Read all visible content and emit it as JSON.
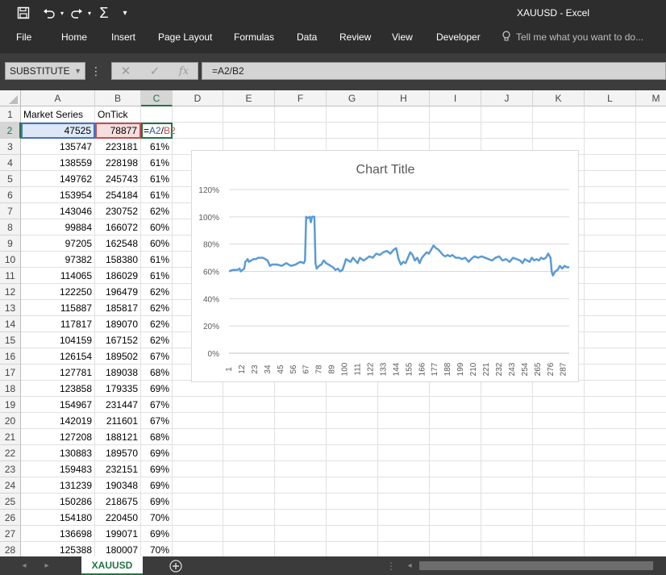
{
  "window": {
    "title": "XAUUSD - Excel"
  },
  "ribbon_tabs": [
    "File",
    "Home",
    "Insert",
    "Page Layout",
    "Formulas",
    "Data",
    "Review",
    "View",
    "Developer"
  ],
  "tell_me": "Tell me what you want to do...",
  "formula_bar": {
    "name_box": "SUBSTITUTE",
    "formula": "=A2/B2",
    "fx": "fx"
  },
  "columns": [
    "A",
    "B",
    "C",
    "D",
    "E",
    "F",
    "G",
    "H",
    "I",
    "J",
    "K",
    "L",
    "M"
  ],
  "headers": {
    "a": "Market Series",
    "b": "OnTick"
  },
  "edit_cell": {
    "eq": "=",
    "ref1": "A2",
    "slash": "/",
    "ref2": "B2"
  },
  "rows": [
    {
      "r": "1"
    },
    {
      "r": "2",
      "a": "47525",
      "b": "78877"
    },
    {
      "r": "3",
      "a": "135747",
      "b": "223181",
      "c": "61%"
    },
    {
      "r": "4",
      "a": "138559",
      "b": "228198",
      "c": "61%"
    },
    {
      "r": "5",
      "a": "149762",
      "b": "245743",
      "c": "61%"
    },
    {
      "r": "6",
      "a": "153954",
      "b": "254184",
      "c": "61%"
    },
    {
      "r": "7",
      "a": "143046",
      "b": "230752",
      "c": "62%"
    },
    {
      "r": "8",
      "a": "99884",
      "b": "166072",
      "c": "60%"
    },
    {
      "r": "9",
      "a": "97205",
      "b": "162548",
      "c": "60%"
    },
    {
      "r": "10",
      "a": "97382",
      "b": "158380",
      "c": "61%"
    },
    {
      "r": "11",
      "a": "114065",
      "b": "186029",
      "c": "61%"
    },
    {
      "r": "12",
      "a": "122250",
      "b": "196479",
      "c": "62%"
    },
    {
      "r": "13",
      "a": "115887",
      "b": "185817",
      "c": "62%"
    },
    {
      "r": "14",
      "a": "117817",
      "b": "189070",
      "c": "62%"
    },
    {
      "r": "15",
      "a": "104159",
      "b": "167152",
      "c": "62%"
    },
    {
      "r": "16",
      "a": "126154",
      "b": "189502",
      "c": "67%"
    },
    {
      "r": "17",
      "a": "127781",
      "b": "189038",
      "c": "68%"
    },
    {
      "r": "18",
      "a": "123858",
      "b": "179335",
      "c": "69%"
    },
    {
      "r": "19",
      "a": "154967",
      "b": "231447",
      "c": "67%"
    },
    {
      "r": "20",
      "a": "142019",
      "b": "211601",
      "c": "67%"
    },
    {
      "r": "21",
      "a": "127208",
      "b": "188121",
      "c": "68%"
    },
    {
      "r": "22",
      "a": "130883",
      "b": "189570",
      "c": "69%"
    },
    {
      "r": "23",
      "a": "159483",
      "b": "232151",
      "c": "69%"
    },
    {
      "r": "24",
      "a": "131239",
      "b": "190348",
      "c": "69%"
    },
    {
      "r": "25",
      "a": "150286",
      "b": "218675",
      "c": "69%"
    },
    {
      "r": "26",
      "a": "154180",
      "b": "220450",
      "c": "70%"
    },
    {
      "r": "27",
      "a": "136698",
      "b": "199071",
      "c": "69%"
    },
    {
      "r": "28",
      "a": "125388",
      "b": "180007",
      "c": "70%"
    }
  ],
  "sheet_tab": "XAUUSD",
  "colors": {
    "excel_green": "#217346",
    "series": "#5b9bd5",
    "ref_blue": "#2f5597",
    "ref_red": "#c0504d"
  },
  "chart_data": {
    "type": "line",
    "title": "Chart Title",
    "ylim": [
      0,
      1.2
    ],
    "y_ticks": [
      "0%",
      "20%",
      "40%",
      "60%",
      "80%",
      "100%",
      "120%"
    ],
    "x_ticks": [
      "1",
      "12",
      "23",
      "34",
      "45",
      "56",
      "67",
      "78",
      "89",
      "100",
      "111",
      "122",
      "133",
      "144",
      "155",
      "166",
      "177",
      "188",
      "199",
      "210",
      "221",
      "232",
      "243",
      "254",
      "265",
      "276",
      "287"
    ],
    "grid": true,
    "legend": "none",
    "x_range": [
      1,
      292
    ],
    "series": [
      {
        "points": [
          [
            1,
            0.6
          ],
          [
            4,
            0.61
          ],
          [
            8,
            0.61
          ],
          [
            10,
            0.62
          ],
          [
            11,
            0.6
          ],
          [
            14,
            0.62
          ],
          [
            15,
            0.67
          ],
          [
            16,
            0.68
          ],
          [
            17,
            0.69
          ],
          [
            18,
            0.67
          ],
          [
            20,
            0.68
          ],
          [
            22,
            0.69
          ],
          [
            24,
            0.69
          ],
          [
            26,
            0.7
          ],
          [
            30,
            0.7
          ],
          [
            34,
            0.68
          ],
          [
            36,
            0.64
          ],
          [
            38,
            0.65
          ],
          [
            42,
            0.65
          ],
          [
            46,
            0.64
          ],
          [
            50,
            0.66
          ],
          [
            54,
            0.64
          ],
          [
            58,
            0.65
          ],
          [
            62,
            0.67
          ],
          [
            65,
            0.66
          ],
          [
            66,
            0.68
          ],
          [
            67,
            1.0
          ],
          [
            68,
            0.99
          ],
          [
            70,
            1.0
          ],
          [
            71,
            0.96
          ],
          [
            72,
            1.0
          ],
          [
            74,
            1.0
          ],
          [
            75,
            0.66
          ],
          [
            76,
            0.62
          ],
          [
            78,
            0.64
          ],
          [
            80,
            0.65
          ],
          [
            82,
            0.68
          ],
          [
            84,
            0.66
          ],
          [
            86,
            0.65
          ],
          [
            88,
            0.64
          ],
          [
            90,
            0.63
          ],
          [
            92,
            0.61
          ],
          [
            94,
            0.62
          ],
          [
            96,
            0.6
          ],
          [
            98,
            0.61
          ],
          [
            100,
            0.66
          ],
          [
            101,
            0.69
          ],
          [
            103,
            0.68
          ],
          [
            105,
            0.67
          ],
          [
            107,
            0.7
          ],
          [
            109,
            0.68
          ],
          [
            111,
            0.66
          ],
          [
            113,
            0.7
          ],
          [
            116,
            0.68
          ],
          [
            118,
            0.69
          ],
          [
            121,
            0.71
          ],
          [
            124,
            0.7
          ],
          [
            127,
            0.73
          ],
          [
            130,
            0.72
          ],
          [
            133,
            0.74
          ],
          [
            136,
            0.75
          ],
          [
            139,
            0.73
          ],
          [
            142,
            0.76
          ],
          [
            144,
            0.77
          ],
          [
            146,
            0.69
          ],
          [
            148,
            0.65
          ],
          [
            150,
            0.67
          ],
          [
            152,
            0.66
          ],
          [
            154,
            0.7
          ],
          [
            156,
            0.74
          ],
          [
            158,
            0.72
          ],
          [
            160,
            0.68
          ],
          [
            162,
            0.7
          ],
          [
            164,
            0.66
          ],
          [
            166,
            0.7
          ],
          [
            168,
            0.72
          ],
          [
            170,
            0.74
          ],
          [
            172,
            0.73
          ],
          [
            174,
            0.76
          ],
          [
            176,
            0.79
          ],
          [
            178,
            0.77
          ],
          [
            180,
            0.76
          ],
          [
            182,
            0.74
          ],
          [
            184,
            0.72
          ],
          [
            186,
            0.71
          ],
          [
            188,
            0.72
          ],
          [
            190,
            0.71
          ],
          [
            192,
            0.72
          ],
          [
            195,
            0.7
          ],
          [
            198,
            0.7
          ],
          [
            200,
            0.69
          ],
          [
            203,
            0.7
          ],
          [
            206,
            0.67
          ],
          [
            208,
            0.69
          ],
          [
            211,
            0.71
          ],
          [
            214,
            0.7
          ],
          [
            217,
            0.71
          ],
          [
            220,
            0.7
          ],
          [
            223,
            0.69
          ],
          [
            226,
            0.68
          ],
          [
            229,
            0.7
          ],
          [
            232,
            0.71
          ],
          [
            235,
            0.68
          ],
          [
            238,
            0.69
          ],
          [
            241,
            0.67
          ],
          [
            244,
            0.7
          ],
          [
            247,
            0.69
          ],
          [
            250,
            0.68
          ],
          [
            252,
            0.66
          ],
          [
            254,
            0.69
          ],
          [
            256,
            0.68
          ],
          [
            258,
            0.67
          ],
          [
            260,
            0.7
          ],
          [
            262,
            0.68
          ],
          [
            264,
            0.69
          ],
          [
            266,
            0.68
          ],
          [
            268,
            0.7
          ],
          [
            270,
            0.69
          ],
          [
            272,
            0.7
          ],
          [
            274,
            0.73
          ],
          [
            276,
            0.7
          ],
          [
            277,
            0.6
          ],
          [
            278,
            0.57
          ],
          [
            280,
            0.6
          ],
          [
            282,
            0.61
          ],
          [
            284,
            0.64
          ],
          [
            286,
            0.62
          ],
          [
            288,
            0.64
          ],
          [
            290,
            0.63
          ],
          [
            292,
            0.63
          ]
        ]
      }
    ]
  }
}
